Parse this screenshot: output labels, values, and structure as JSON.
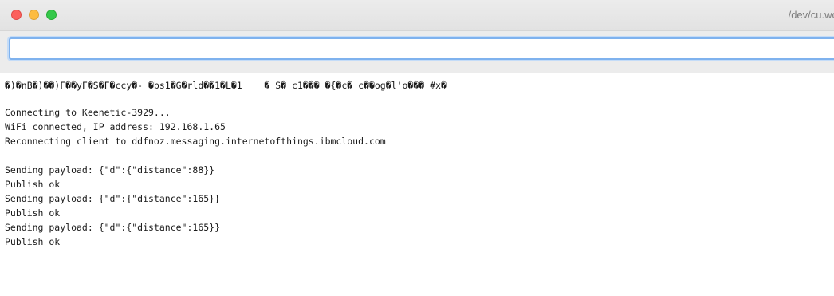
{
  "window": {
    "title": "/dev/cu.wc"
  },
  "toolbar": {
    "send_input_value": ""
  },
  "console": {
    "lines": [
      "�)�nB�)��)F��yF�S�F�ccy�- �bs1�G�rld��1�L�1    � S� c1��� �{�c� c��og�l'o��� #x�",
      "",
      "Connecting to Keenetic-3929...",
      "WiFi connected, IP address: 192.168.1.65",
      "Reconnecting client to ddfnoz.messaging.internetofthings.ibmcloud.com",
      "",
      "Sending payload: {\"d\":{\"distance\":88}}",
      "Publish ok",
      "Sending payload: {\"d\":{\"distance\":165}}",
      "Publish ok",
      "Sending payload: {\"d\":{\"distance\":165}}",
      "Publish ok"
    ]
  }
}
